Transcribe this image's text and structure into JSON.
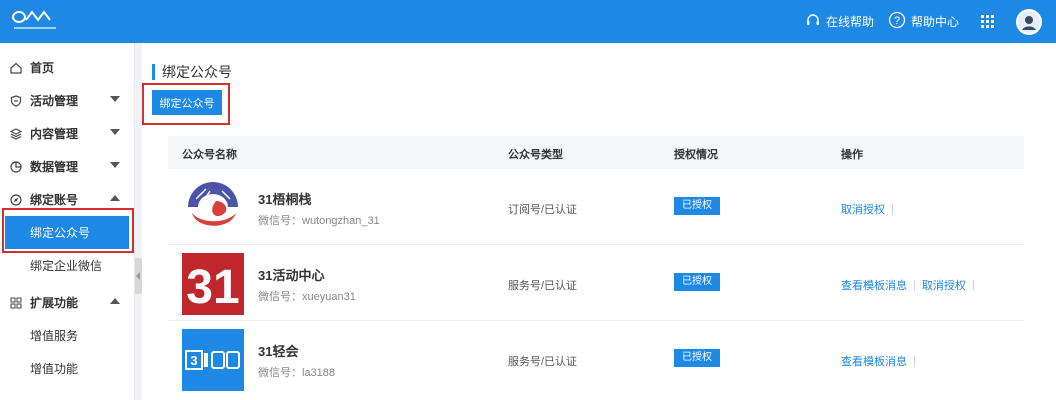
{
  "topbar": {
    "help_online": "在线帮助",
    "help_center": "帮助中心"
  },
  "sidebar": {
    "home": "首页",
    "activity": "活动管理",
    "content": "内容管理",
    "data": "数据管理",
    "bind_account": "绑定账号",
    "sub_bind_mp": "绑定公众号",
    "sub_bind_wecom": "绑定企业微信",
    "extend": "扩展功能",
    "sub_value_service": "增值服务",
    "sub_value_feature": "增值功能"
  },
  "main": {
    "title": "绑定公众号",
    "bind_button": "绑定公众号",
    "columns": {
      "name": "公众号名称",
      "type": "公众号类型",
      "auth": "授权情况",
      "ops": "操作"
    },
    "rows": [
      {
        "name": "31梧桐栈",
        "wechat_id": "微信号：wutongzhan_31",
        "type": "订阅号/已认证",
        "auth": "已授权",
        "ops": [
          "取消授权"
        ]
      },
      {
        "name": "31活动中心",
        "wechat_id": "微信号：xueyuan31",
        "type": "服务号/已认证",
        "auth": "已授权",
        "ops": [
          "查看模板消息",
          "取消授权"
        ]
      },
      {
        "name": "31轻会",
        "wechat_id": "微信号：la3188",
        "type": "服务号/已认证",
        "auth": "已授权",
        "ops": [
          "查看模板消息"
        ]
      }
    ]
  },
  "colors": {
    "primary": "#1e88e5",
    "highlight_outline": "#d32f2f"
  }
}
